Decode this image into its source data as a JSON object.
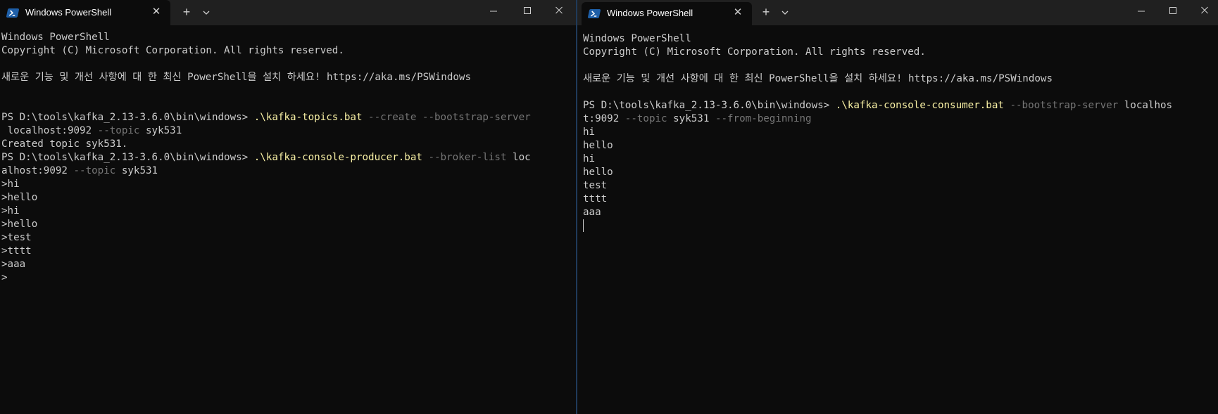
{
  "colors": {
    "background": "#0c0c0c",
    "titlebar": "#202020",
    "text": "#cccccc",
    "command": "#f9f1a5",
    "parameter": "#767676"
  },
  "left": {
    "tab_title": "Windows PowerShell",
    "lines": [
      [
        {
          "t": "Windows PowerShell"
        }
      ],
      [
        {
          "t": "Copyright (C) Microsoft Corporation. All rights reserved."
        }
      ],
      [],
      [
        {
          "t": "새로운 기능 및 개선 사항에 대 한 최신 PowerShell을 설치 하세요! https://aka.ms/PSWindows"
        }
      ],
      [],
      [],
      [
        {
          "t": "PS D:\\tools\\kafka_2.13-3.6.0\\bin\\windows> "
        },
        {
          "t": ".\\kafka-topics.bat",
          "c": "cmd"
        },
        {
          "t": " --create --bootstrap-server",
          "c": "param"
        }
      ],
      [
        {
          "t": " localhost:9092 "
        },
        {
          "t": "--topic",
          "c": "param"
        },
        {
          "t": " syk531"
        }
      ],
      [
        {
          "t": "Created topic syk531."
        }
      ],
      [
        {
          "t": "PS D:\\tools\\kafka_2.13-3.6.0\\bin\\windows> "
        },
        {
          "t": ".\\kafka-console-producer.bat",
          "c": "cmd"
        },
        {
          "t": " --broker-list",
          "c": "param"
        },
        {
          "t": " loc"
        }
      ],
      [
        {
          "t": "alhost:9092 "
        },
        {
          "t": "--topic",
          "c": "param"
        },
        {
          "t": " syk531"
        }
      ],
      [
        {
          "t": ">hi"
        }
      ],
      [
        {
          "t": ">hello"
        }
      ],
      [
        {
          "t": ">hi"
        }
      ],
      [
        {
          "t": ">hello"
        }
      ],
      [
        {
          "t": ">test"
        }
      ],
      [
        {
          "t": ">tttt"
        }
      ],
      [
        {
          "t": ">aaa"
        }
      ],
      [
        {
          "t": ">"
        }
      ]
    ]
  },
  "right": {
    "tab_title": "Windows PowerShell",
    "lines": [
      [
        {
          "t": "Windows PowerShell"
        }
      ],
      [
        {
          "t": "Copyright (C) Microsoft Corporation. All rights reserved."
        }
      ],
      [],
      [
        {
          "t": "새로운 기능 및 개선 사항에 대 한 최신 PowerShell을 설치 하세요! https://aka.ms/PSWindows"
        }
      ],
      [],
      [
        {
          "t": "PS D:\\tools\\kafka_2.13-3.6.0\\bin\\windows> "
        },
        {
          "t": ".\\kafka-console-consumer.bat",
          "c": "cmd"
        },
        {
          "t": " --bootstrap-server",
          "c": "param"
        },
        {
          "t": " localhos"
        }
      ],
      [
        {
          "t": "t:9092 "
        },
        {
          "t": "--topic",
          "c": "param"
        },
        {
          "t": " syk531 "
        },
        {
          "t": "--from-beginning",
          "c": "param"
        }
      ],
      [
        {
          "t": "hi"
        }
      ],
      [
        {
          "t": "hello"
        }
      ],
      [
        {
          "t": "hi"
        }
      ],
      [
        {
          "t": "hello"
        }
      ],
      [
        {
          "t": "test"
        }
      ],
      [
        {
          "t": "tttt"
        }
      ],
      [
        {
          "t": "aaa"
        }
      ],
      [
        {
          "cursor": true
        }
      ]
    ]
  },
  "icons": {
    "tab_icon": "powershell-icon",
    "close": "close-icon",
    "new_tab": "plus-icon",
    "dropdown": "chevron-down-icon",
    "minimize": "minimize-icon",
    "maximize": "maximize-icon",
    "window_close": "window-close-icon"
  }
}
